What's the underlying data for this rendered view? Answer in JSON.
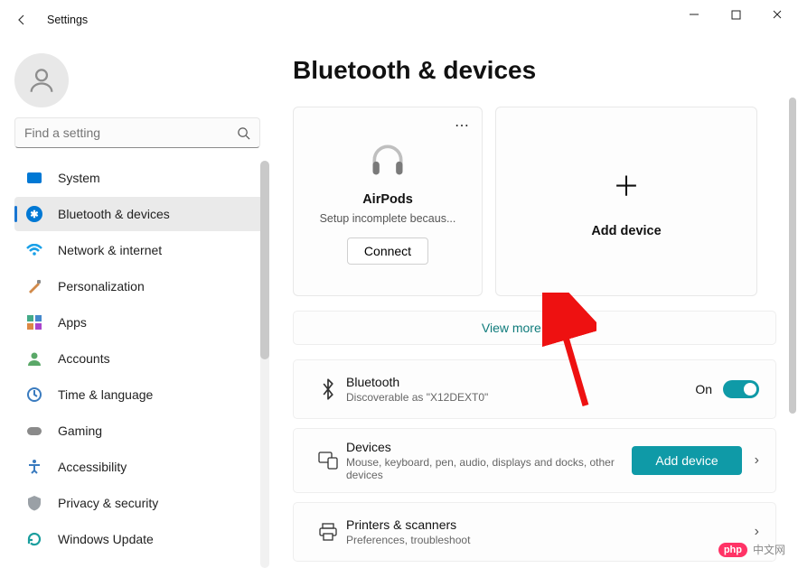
{
  "window": {
    "title": "Settings"
  },
  "search": {
    "placeholder": "Find a setting"
  },
  "nav": {
    "items": [
      {
        "label": "System"
      },
      {
        "label": "Bluetooth & devices"
      },
      {
        "label": "Network & internet"
      },
      {
        "label": "Personalization"
      },
      {
        "label": "Apps"
      },
      {
        "label": "Accounts"
      },
      {
        "label": "Time & language"
      },
      {
        "label": "Gaming"
      },
      {
        "label": "Accessibility"
      },
      {
        "label": "Privacy & security"
      },
      {
        "label": "Windows Update"
      }
    ],
    "active_index": 1
  },
  "page": {
    "title": "Bluetooth & devices"
  },
  "device_card": {
    "name": "AirPods",
    "subtitle": "Setup incomplete becaus...",
    "connect": "Connect"
  },
  "add_card": {
    "label": "Add device"
  },
  "view_more": "View more devices",
  "bluetooth_row": {
    "title": "Bluetooth",
    "subtitle": "Discoverable as \"X12DEXT0\"",
    "state_label": "On"
  },
  "devices_row": {
    "title": "Devices",
    "subtitle": "Mouse, keyboard, pen, audio, displays and docks, other devices",
    "button": "Add device"
  },
  "printers_row": {
    "title": "Printers & scanners",
    "subtitle": "Preferences, troubleshoot"
  },
  "watermark": {
    "badge": "php",
    "text": "中文网"
  }
}
